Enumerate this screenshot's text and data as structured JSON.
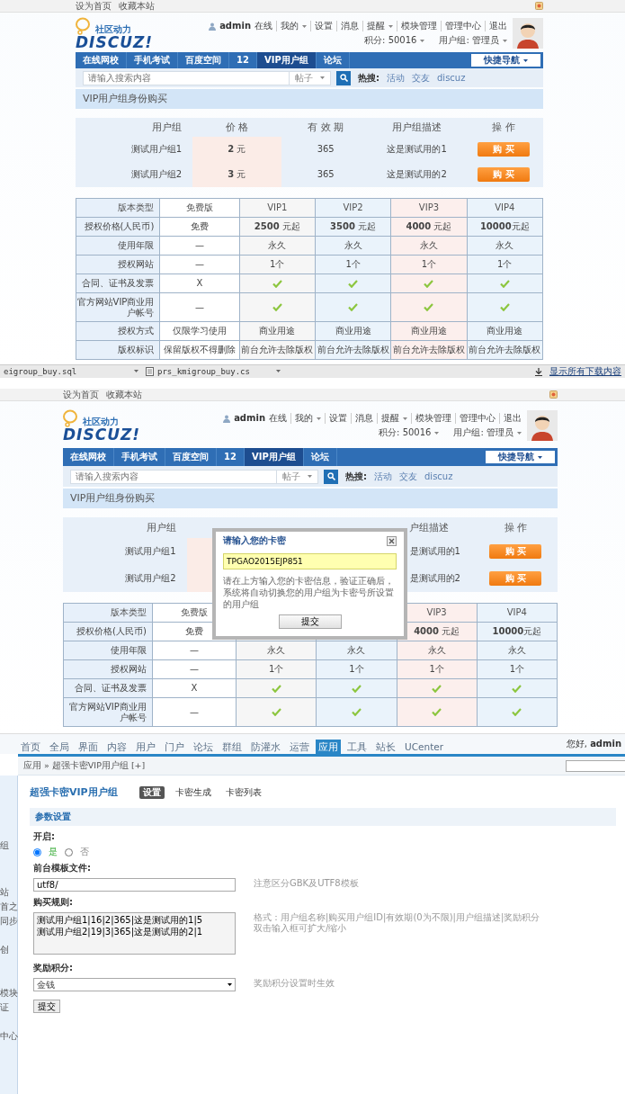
{
  "panel_1": {
    "top_links": [
      "设为首页",
      "收藏本站"
    ],
    "logo": {
      "tagline": "社区动力",
      "wordmark": "DISCUZ!"
    },
    "user": {
      "name": "admin",
      "status": "在线"
    },
    "user_links": [
      {
        "label": "我的",
        "dropdown": true
      },
      {
        "label": "设置",
        "dropdown": false
      },
      {
        "label": "消息",
        "dropdown": false
      },
      {
        "label": "提醒",
        "dropdown": true
      },
      {
        "label": "模块管理",
        "dropdown": false
      },
      {
        "label": "管理中心",
        "dropdown": false
      },
      {
        "label": "退出",
        "dropdown": false
      }
    ],
    "stats": [
      {
        "label": "积分: 50016",
        "dropdown": true
      },
      {
        "label": "用户组: 管理员",
        "dropdown": true
      }
    ],
    "nav": [
      {
        "label": "在线网校",
        "selected": false
      },
      {
        "label": "手机考试",
        "selected": false
      },
      {
        "label": "百度空间",
        "selected": false
      },
      {
        "label": "12",
        "selected": false
      },
      {
        "label": "VIP用户组",
        "selected": true
      },
      {
        "label": "论坛",
        "selected": false
      }
    ],
    "quick_nav": "快捷导航",
    "search": {
      "placeholder": "请输入搜索内容",
      "scope": "帖子",
      "hot_label": "热搜:",
      "hot": [
        "活动",
        "交友",
        "discuz"
      ]
    },
    "page_title": "VIP用户组身份购买",
    "groups": {
      "columns": [
        "用户组",
        "价 格",
        "有 效 期",
        "用户组描述",
        "操 作"
      ],
      "rows": [
        {
          "name": "测试用户组1",
          "price": "**2** 元",
          "period": "365",
          "description": "这是测试用的1",
          "action": "购 买"
        },
        {
          "name": "测试用户组2",
          "price": "**3** 元",
          "period": "365",
          "description": "这是测试用的2",
          "action": "购 买"
        }
      ]
    },
    "compare": {
      "corner": "版本类型",
      "columns": [
        "免费版",
        "VIP1",
        "VIP2",
        "VIP3",
        "VIP4"
      ],
      "rows": [
        {
          "label": "授权价格(人民币)",
          "cells": [
            {
              "kind": "text",
              "text": "免费"
            },
            {
              "kind": "text",
              "text": "**2500** 元起"
            },
            {
              "kind": "text",
              "text": "**3500** 元起"
            },
            {
              "kind": "text",
              "text": "**4000** 元起"
            },
            {
              "kind": "text",
              "text": "**10000**元起"
            }
          ]
        },
        {
          "label": "使用年限",
          "cells": [
            {
              "kind": "text",
              "text": "—"
            },
            {
              "kind": "text",
              "text": "永久"
            },
            {
              "kind": "text",
              "text": "永久"
            },
            {
              "kind": "text",
              "text": "永久"
            },
            {
              "kind": "text",
              "text": "永久"
            }
          ]
        },
        {
          "label": "授权网站",
          "cells": [
            {
              "kind": "text",
              "text": "—"
            },
            {
              "kind": "text",
              "text": "1个"
            },
            {
              "kind": "text",
              "text": "1个"
            },
            {
              "kind": "text",
              "text": "1个"
            },
            {
              "kind": "text",
              "text": "1个"
            }
          ]
        },
        {
          "label": "合同、证书及发票",
          "cells": [
            {
              "kind": "text",
              "text": "X"
            },
            {
              "kind": "check"
            },
            {
              "kind": "check"
            },
            {
              "kind": "check"
            },
            {
              "kind": "check"
            }
          ]
        },
        {
          "label": "官方网站VIP商业用户帐号",
          "cells": [
            {
              "kind": "text",
              "text": "—"
            },
            {
              "kind": "check"
            },
            {
              "kind": "check"
            },
            {
              "kind": "check"
            },
            {
              "kind": "check"
            }
          ]
        },
        {
          "label": "授权方式",
          "cells": [
            {
              "kind": "text",
              "text": "仅限学习使用"
            },
            {
              "kind": "text",
              "text": "商业用途"
            },
            {
              "kind": "text",
              "text": "商业用途"
            },
            {
              "kind": "text",
              "text": "商业用途"
            },
            {
              "kind": "text",
              "text": "商业用途"
            }
          ]
        },
        {
          "label": "版权标识",
          "cells": [
            {
              "kind": "text",
              "text": "保留版权不得删除"
            },
            {
              "kind": "text",
              "text": "前台允许去除版权"
            },
            {
              "kind": "text",
              "text": "前台允许去除版权"
            },
            {
              "kind": "text",
              "text": "前台允许去除版权"
            },
            {
              "kind": "text",
              "text": "前台允许去除版权"
            }
          ]
        }
      ]
    }
  },
  "download_bar": {
    "files": [
      "eigroup_buy.sql",
      "prs_kmigroup_buy.cs"
    ],
    "show_all": "显示所有下载内容"
  },
  "panel_2": {
    "top_links": [
      "设为首页",
      "收藏本站"
    ],
    "logo": {
      "tagline": "社区动力",
      "wordmark": "DISCUZ!"
    },
    "user": {
      "name": "admin",
      "status": "在线"
    },
    "user_links": [
      {
        "label": "我的",
        "dropdown": true
      },
      {
        "label": "设置",
        "dropdown": false
      },
      {
        "label": "消息",
        "dropdown": false
      },
      {
        "label": "提醒",
        "dropdown": true
      },
      {
        "label": "模块管理",
        "dropdown": false
      },
      {
        "label": "管理中心",
        "dropdown": false
      },
      {
        "label": "退出",
        "dropdown": false
      }
    ],
    "stats": [
      {
        "label": "积分: 50016",
        "dropdown": true
      },
      {
        "label": "用户组: 管理员",
        "dropdown": true
      }
    ],
    "nav": [
      {
        "label": "在线网校",
        "selected": false
      },
      {
        "label": "手机考试",
        "selected": false
      },
      {
        "label": "百度空间",
        "selected": false
      },
      {
        "label": "12",
        "selected": false
      },
      {
        "label": "VIP用户组",
        "selected": true
      },
      {
        "label": "论坛",
        "selected": false
      }
    ],
    "quick_nav": "快捷导航",
    "search": {
      "placeholder": "请输入搜索内容",
      "scope": "帖子",
      "hot_label": "热搜:",
      "hot": [
        "活动",
        "交友",
        "discuz"
      ]
    },
    "page_title": "VIP用户组身份购买",
    "groups": {
      "columns": [
        "用户组",
        null,
        null,
        "户组描述",
        "操 作"
      ],
      "rows": [
        {
          "name": "测试用户组1",
          "price": null,
          "period": null,
          "description": "是测试用的1",
          "action": "购 买"
        },
        {
          "name": "测试用户组2",
          "price": null,
          "period": null,
          "description": "是测试用的2",
          "action": "购 买"
        }
      ]
    },
    "compare": {
      "corner": "版本类型",
      "columns": [
        "免费版",
        null,
        null,
        "VIP3",
        "VIP4"
      ],
      "rows": [
        {
          "label": "授权价格(人民币)",
          "cells": [
            {
              "kind": "text",
              "text": "免费"
            },
            null,
            null,
            {
              "kind": "text",
              "text": "**4000** 元起"
            },
            {
              "kind": "text",
              "text": "**10000**元起"
            }
          ]
        },
        {
          "label": "使用年限",
          "cells": [
            {
              "kind": "text",
              "text": "—"
            },
            {
              "kind": "text",
              "text": "永久"
            },
            {
              "kind": "text",
              "text": "永久"
            },
            {
              "kind": "text",
              "text": "永久"
            },
            {
              "kind": "text",
              "text": "永久"
            }
          ]
        },
        {
          "label": "授权网站",
          "cells": [
            {
              "kind": "text",
              "text": "—"
            },
            {
              "kind": "text",
              "text": "1个"
            },
            {
              "kind": "text",
              "text": "1个"
            },
            {
              "kind": "text",
              "text": "1个"
            },
            {
              "kind": "text",
              "text": "1个"
            }
          ]
        },
        {
          "label": "合同、证书及发票",
          "cells": [
            {
              "kind": "text",
              "text": "X"
            },
            {
              "kind": "check"
            },
            {
              "kind": "check"
            },
            {
              "kind": "check"
            },
            {
              "kind": "check"
            }
          ]
        },
        {
          "label": "官方网站VIP商业用户帐号",
          "cells": [
            {
              "kind": "text",
              "text": "—"
            },
            {
              "kind": "check"
            },
            {
              "kind": "check"
            },
            {
              "kind": "check"
            },
            {
              "kind": "check"
            }
          ]
        }
      ]
    },
    "dialog": {
      "title": "请输入您的卡密",
      "code": "TPGAO2015EJP851",
      "hint": "请在上方输入您的卡密信息，验证正确后，系统将自动切换您的用户组为卡密号所设置的用户组",
      "submit": "提交"
    }
  },
  "panel_3": {
    "top_nav": [
      {
        "label": "首页",
        "selected": false
      },
      {
        "label": "全局",
        "selected": false
      },
      {
        "label": "界面",
        "selected": false
      },
      {
        "label": "内容",
        "selected": false
      },
      {
        "label": "用户",
        "selected": false
      },
      {
        "label": "门户",
        "selected": false
      },
      {
        "label": "论坛",
        "selected": false
      },
      {
        "label": "群组",
        "selected": false
      },
      {
        "label": "防灌水",
        "selected": false
      },
      {
        "label": "运营",
        "selected": false
      },
      {
        "label": "应用",
        "selected": true
      },
      {
        "label": "工具",
        "selected": false
      },
      {
        "label": "站长",
        "selected": false
      },
      {
        "label": "UCenter",
        "selected": false
      }
    ],
    "greeting": "您好, **admin**",
    "breadcrumb": "应用 » 超强卡密VIP用户组 [+]",
    "sidebar_fragments": [
      "组",
      "站",
      "首之",
      "同步",
      "创",
      "模块",
      "证",
      "中心"
    ],
    "plugin_title": "超强卡密VIP用户组",
    "tabs": [
      {
        "label": "设置",
        "selected": true
      },
      {
        "label": "卡密生成",
        "selected": false
      },
      {
        "label": "卡密列表",
        "selected": false
      }
    ],
    "section": "参数设置",
    "settings": [
      {
        "kind": "radio",
        "label": "开启:",
        "options": [
          {
            "label": "是",
            "selected": true
          },
          {
            "label": "否",
            "selected": false
          }
        ]
      },
      {
        "kind": "text",
        "label": "前台模板文件:",
        "value": "utf8/",
        "hints": [
          "注意区分GBK及UTF8模板"
        ]
      },
      {
        "kind": "textarea",
        "label": "购买规则:",
        "lines": [
          "测试用户组1|16|2|365|这是测试用的1|5",
          "测试用户组2|19|3|365|这是测试用的2|1"
        ],
        "hints": [
          "格式：用户组名称|购买用户组ID|有效期(0为不限)|用户组描述|奖励积分",
          "双击输入框可扩大/缩小"
        ]
      },
      {
        "kind": "select",
        "label": "奖励积分:",
        "value": "金钱",
        "hints": [
          "奖励积分设置时生效"
        ]
      }
    ],
    "submit": "提交"
  }
}
